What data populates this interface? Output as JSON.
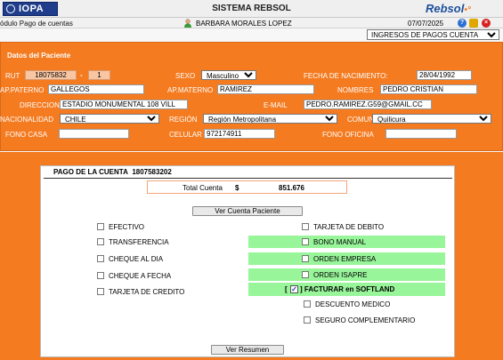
{
  "header": {
    "logo_text": "IOPA",
    "system_title": "SISTEMA REBSOL",
    "brand": "Rebsol",
    "module": "ódulo Pago de cuentas",
    "user_name": "BARBARA MORALES LOPEZ",
    "date": "07/07/2025",
    "icons": [
      "help-icon",
      "lock-icon",
      "close-icon"
    ]
  },
  "ingresos_select": {
    "value": "INGRESOS DE PAGOS CUENTA"
  },
  "patient": {
    "section_title": "Datos del Paciente",
    "rut_label": "RUT",
    "rut": "18075832",
    "rut_sep": "-",
    "rut_dv": "1",
    "sexo_label": "SEXO",
    "sexo": "Masculino",
    "fecha_nac_label": "FECHA DE NACIMIENTO:",
    "fecha_nac": "28/04/1992",
    "ap_paterno_label": "AP.PATERNO",
    "ap_paterno": "GALLEGOS",
    "ap_materno_label": "AP.MATERNO",
    "ap_materno": "RAMIREZ",
    "nombres_label": "NOMBRES",
    "nombres": "PEDRO CRISTIAN",
    "direccion_label": "DIRECCION",
    "direccion": "ESTADIO MONUMENTAL 108 VILL",
    "email_label": "E-MAIL",
    "email": "PEDRO.RAMIREZ.G59@GMAIL.CC",
    "nacionalidad_label": "NACIONALIDAD",
    "nacionalidad": "CHILE",
    "region_label": "REGIÓN",
    "region": "Región Metropolitana",
    "comuna_label": "COMUNA",
    "comuna": "Quilicura",
    "fono_casa_label": "FONO CASA",
    "fono_casa": "",
    "celular_label": "CELULAR",
    "celular": "972174911",
    "fono_oficina_label": "FONO OFICINA",
    "fono_oficina": ""
  },
  "payment": {
    "title": "PAGO DE LA CUENTA",
    "account_number": "1807583202",
    "total_label": "Total Cuenta",
    "currency": "$",
    "total_value": "851.676",
    "ver_cuenta_button": "Ver Cuenta Paciente",
    "left_options": [
      "EFECTIVO",
      "TRANSFERENCIA",
      "CHEQUE AL DIA",
      "CHEQUE A FECHA",
      "TARJETA DE CREDITO"
    ],
    "right_options": [
      "TARJETA DE DEBITO",
      "BONO MANUAL",
      "ORDEN EMPRESA",
      "ORDEN ISAPRE"
    ],
    "facturar_open": "[",
    "facturar_check": "✓",
    "facturar_label": "] FACTURAR en SOFTLAND",
    "facturar_checked": true,
    "extra_options": [
      "DESCUENTO MEDICO",
      "SEGURO COMPLEMENTARIO"
    ],
    "ver_resumen_button": "Ver Resumen"
  },
  "colors": {
    "accent": "#f47b20",
    "highlight": "#98f59a",
    "brand": "#1c4f9c"
  }
}
